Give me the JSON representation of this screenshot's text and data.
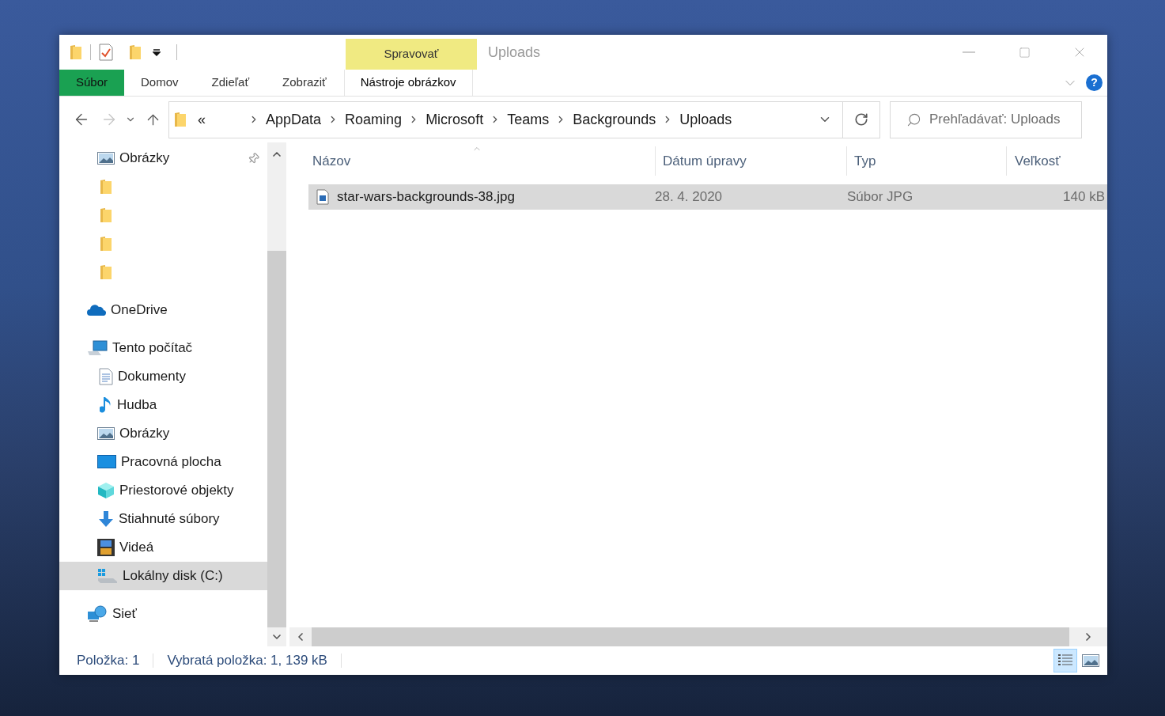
{
  "window": {
    "title": "Uploads",
    "context_tab": "Spravovať"
  },
  "ribbon_tabs": [
    {
      "label": "Súbor",
      "kind": "file",
      "selected": false
    },
    {
      "label": "Domov",
      "kind": "tab",
      "selected": false
    },
    {
      "label": "Zdieľať",
      "kind": "tab",
      "selected": false
    },
    {
      "label": "Zobraziť",
      "kind": "tab",
      "selected": false
    },
    {
      "label": "Nástroje obrázkov",
      "kind": "context",
      "selected": false
    }
  ],
  "address": {
    "crumbs": [
      "«",
      "AppData",
      "Roaming",
      "Microsoft",
      "Teams",
      "Backgrounds",
      "Uploads"
    ]
  },
  "search": {
    "placeholder": "Prehľadávať: Uploads"
  },
  "help": "?",
  "nav": [
    {
      "label": "Obrázky",
      "kind": "pictures",
      "pinned": true,
      "selected": false
    },
    {
      "kind": "folder",
      "pinned": false,
      "selected": false
    },
    {
      "kind": "folder",
      "pinned": false,
      "selected": false
    },
    {
      "kind": "folder",
      "pinned": false,
      "selected": false
    },
    {
      "kind": "folder",
      "pinned": false,
      "selected": false
    },
    {
      "label": "OneDrive",
      "kind": "cloud",
      "selected": false
    },
    {
      "label": "Tento počítač",
      "kind": "pc",
      "selected": false,
      "children": [
        {
          "label": "Dokumenty",
          "kind": "documents",
          "selected": false
        },
        {
          "label": "Hudba",
          "kind": "music",
          "selected": false
        },
        {
          "label": "Obrázky",
          "kind": "pictures",
          "selected": false
        },
        {
          "label": "Pracovná plocha",
          "kind": "desktop",
          "selected": false
        },
        {
          "label": "Priestorové objekty",
          "kind": "cube",
          "selected": false
        },
        {
          "label": "Stiahnuté súbory",
          "kind": "download",
          "selected": false
        },
        {
          "label": "Videá",
          "kind": "video",
          "selected": false
        },
        {
          "label": "Lokálny disk (C:)",
          "kind": "disk",
          "selected": true
        }
      ]
    },
    {
      "label": "Sieť",
      "kind": "network",
      "selected": false
    }
  ],
  "columns": [
    {
      "label": "Názov",
      "sorted": true
    },
    {
      "label": "Dátum úpravy",
      "sorted": false
    },
    {
      "label": "Typ",
      "sorted": false
    },
    {
      "label": "Veľkosť",
      "sorted": false
    }
  ],
  "files": [
    {
      "name": "star-wars-backgrounds-38.jpg",
      "date": "28. 4. 2020",
      "type": "Súbor JPG",
      "size": "140 kB",
      "selected": true
    }
  ],
  "status_bar": {
    "items": [
      "Položka: 1",
      "Vybratá položka: 1, 139 kB"
    ],
    "views": [
      {
        "kind": "details",
        "selected": true
      },
      {
        "kind": "large_icons",
        "selected": false
      }
    ]
  }
}
